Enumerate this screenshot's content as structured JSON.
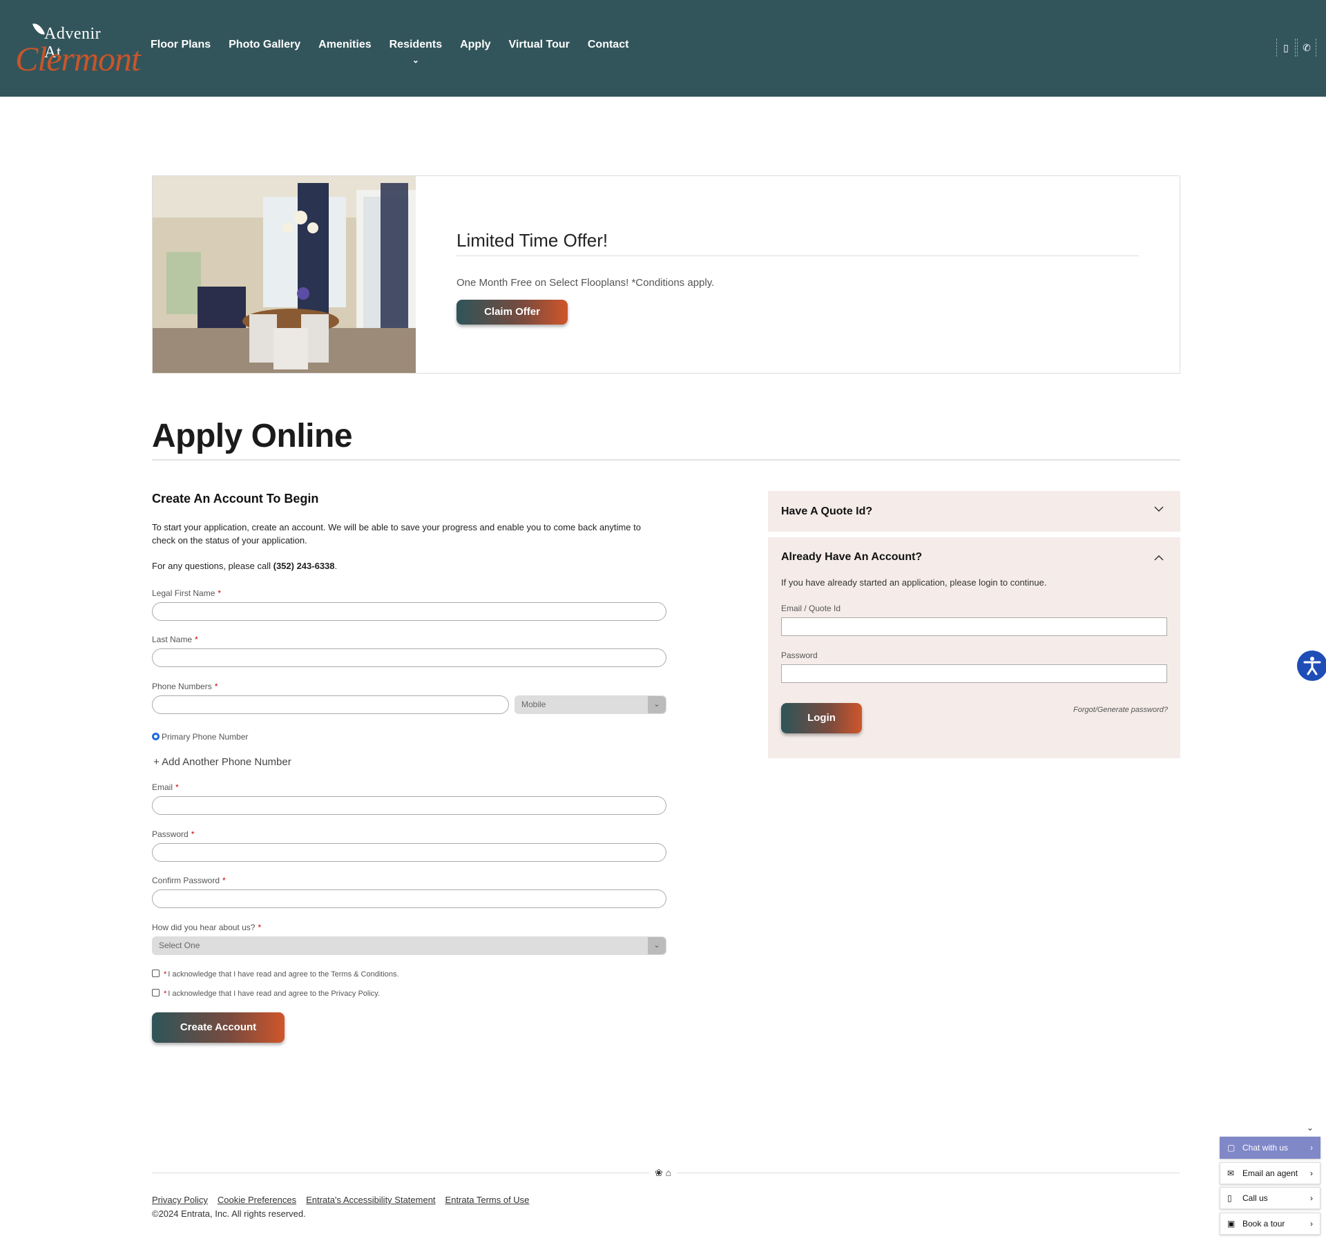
{
  "header": {
    "logo_line1": "Advenir At",
    "logo_line2": "Clermont",
    "nav": [
      "Floor Plans",
      "Photo Gallery",
      "Amenities",
      "Residents",
      "Apply",
      "Virtual Tour",
      "Contact"
    ],
    "residents_chevron": "⌄",
    "icon_building": "▯",
    "icon_phone": "✆"
  },
  "offer": {
    "title": "Limited Time Offer!",
    "text": "One Month Free on Select Flooplans! *Conditions apply.",
    "button": "Claim Offer"
  },
  "apply": {
    "title": "Apply Online"
  },
  "create": {
    "title": "Create An Account To Begin",
    "intro": "To start your application, create an account. We will be able to save your progress and enable you to come back anytime to check on the status of your application.",
    "call_prefix": "For any questions, please call ",
    "phone": "(352) 243-6338",
    "call_suffix": ".",
    "first_name_label": "Legal First Name",
    "last_name_label": "Last Name",
    "phone_label": "Phone Numbers",
    "phone_type": "Mobile",
    "primary_phone": "Primary Phone Number",
    "add_phone": "Add Another Phone Number",
    "email_label": "Email",
    "password_label": "Password",
    "confirm_label": "Confirm Password",
    "hear_label": "How did you hear about us?",
    "hear_value": "Select One",
    "terms": "I acknowledge that I have read and agree to the Terms & Conditions.",
    "privacy": "I acknowledge that I have read and agree to the Privacy Policy.",
    "button": "Create Account",
    "required_mark": "*"
  },
  "quote": {
    "title": "Have A Quote Id?"
  },
  "account": {
    "title": "Already Have An Account?",
    "desc": "If you have already started an application, please login to continue.",
    "email_label": "Email / Quote Id",
    "password_label": "Password",
    "login": "Login",
    "forgot": "Forgot/Generate password?"
  },
  "footer": {
    "links": [
      "Privacy Policy",
      "Cookie Preferences",
      "Entrata's Accessibility Statement",
      "Entrata Terms of Use"
    ],
    "copyright": "©2024 Entrata, Inc. All rights reserved."
  },
  "cta": {
    "chat": "Chat with us",
    "email": "Email an agent",
    "call": "Call us",
    "tour": "Book a tour"
  }
}
